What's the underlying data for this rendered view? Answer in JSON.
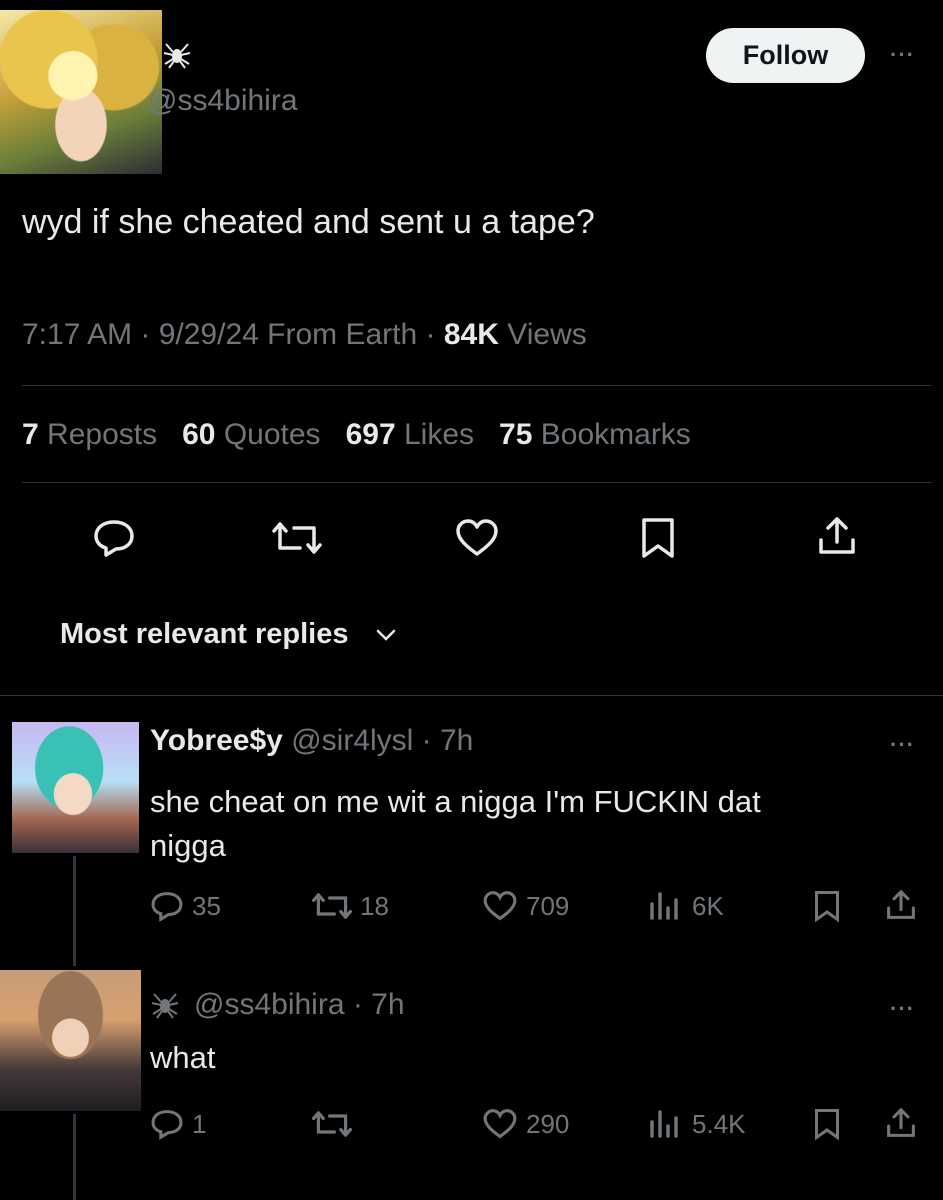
{
  "tweet": {
    "handle": "@ss4bihira",
    "follow_label": "Follow",
    "text": "wyd if she cheated and sent u a tape?",
    "meta_time": "7:17 AM · 9/29/24 From Earth ·",
    "views_count": "84K",
    "views_label": "Views",
    "reposts_count": "7",
    "reposts_label": "Reposts",
    "quotes_count": "60",
    "quotes_label": "Quotes",
    "likes_count": "697",
    "likes_label": "Likes",
    "bookmarks_count": "75",
    "bookmarks_label": "Bookmarks"
  },
  "replies_header": {
    "label": "Most relevant replies"
  },
  "replies": [
    {
      "display_name": "Yobree$y",
      "handle_time": "@sir4lysl · 7h",
      "text_line1": "she cheat on me wit a nigga I'm FUCKIN dat",
      "text_line2": "nigga",
      "replies": "35",
      "reposts": "18",
      "likes": "709",
      "views": "6K"
    },
    {
      "handle_time": "@ss4bihira · 7h",
      "text": "what",
      "replies": "1",
      "likes": "290",
      "views": "5.4K"
    }
  ],
  "icons": {
    "reply": "reply-icon",
    "repost": "repost-icon",
    "like": "heart-icon",
    "bookmark": "bookmark-icon",
    "share": "share-icon",
    "views": "analytics-icon",
    "more": "more-icon",
    "spider": "spider-icon"
  },
  "colors": {
    "background": "#000000",
    "text": "#e7e9ea",
    "muted": "#71767b",
    "follow_bg": "#eff3f4"
  }
}
